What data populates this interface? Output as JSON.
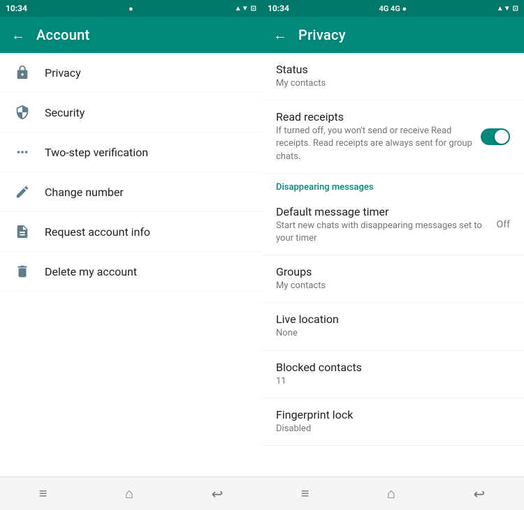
{
  "account_panel": {
    "status_bar": {
      "time": "10:34",
      "signal": "●",
      "icons_right": "⊕ ▲ ▼ ⊡"
    },
    "header": {
      "title": "Account",
      "back_label": "←"
    },
    "menu_items": [
      {
        "id": "privacy",
        "label": "Privacy",
        "icon": "lock"
      },
      {
        "id": "security",
        "label": "Security",
        "icon": "shield"
      },
      {
        "id": "two-step",
        "label": "Two-step verification",
        "icon": "dots"
      },
      {
        "id": "change-number",
        "label": "Change number",
        "icon": "phone-edit"
      },
      {
        "id": "request-info",
        "label": "Request account info",
        "icon": "file"
      },
      {
        "id": "delete-account",
        "label": "Delete my account",
        "icon": "trash"
      }
    ],
    "nav": {
      "menu": "≡",
      "home": "⌂",
      "back": "↩"
    }
  },
  "privacy_panel": {
    "status_bar": {
      "time": "10:34",
      "signal_left": "4G 4G ●",
      "icons_right": "⊕ ▲ ▼ ⊡"
    },
    "header": {
      "title": "Privacy",
      "back_label": "←"
    },
    "items": [
      {
        "id": "status",
        "title": "Status",
        "subtitle": "My contacts",
        "value": "",
        "has_toggle": false
      },
      {
        "id": "read-receipts",
        "title": "Read receipts",
        "subtitle": "If turned off, you won't send or receive Read receipts. Read receipts are always sent for group chats.",
        "value": "",
        "has_toggle": true
      },
      {
        "id": "disappearing-section",
        "section_label": "Disappearing messages",
        "is_section": true
      },
      {
        "id": "default-message-timer",
        "title": "Default message timer",
        "subtitle": "Start new chats with disappearing messages set to your timer",
        "value": "Off",
        "has_toggle": false
      },
      {
        "id": "groups",
        "title": "Groups",
        "subtitle": "My contacts",
        "value": "",
        "has_toggle": false
      },
      {
        "id": "live-location",
        "title": "Live location",
        "subtitle": "None",
        "value": "",
        "has_toggle": false
      },
      {
        "id": "blocked-contacts",
        "title": "Blocked contacts",
        "subtitle": "11",
        "value": "",
        "has_toggle": false
      },
      {
        "id": "fingerprint-lock",
        "title": "Fingerprint lock",
        "subtitle": "Disabled",
        "value": "",
        "has_toggle": false
      }
    ],
    "nav": {
      "menu": "≡",
      "home": "⌂",
      "back": "↩"
    }
  }
}
